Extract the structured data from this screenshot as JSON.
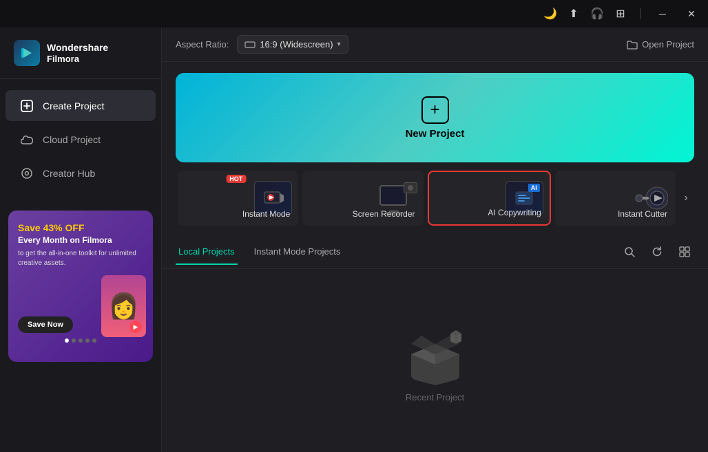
{
  "titlebar": {
    "icons": [
      "sun-icon",
      "upload-icon",
      "headset-icon",
      "grid-icon",
      "minimize-icon",
      "close-icon"
    ]
  },
  "sidebar": {
    "logo": {
      "title": "Wondershare",
      "subtitle": "Filmora"
    },
    "nav": [
      {
        "id": "create-project",
        "label": "Create Project",
        "icon": "➕",
        "active": true
      },
      {
        "id": "cloud-project",
        "label": "Cloud Project",
        "icon": "☁",
        "active": false
      },
      {
        "id": "creator-hub",
        "label": "Creator Hub",
        "icon": "💡",
        "active": false
      }
    ],
    "ad": {
      "title_line1": "Save 43% OFF",
      "subtitle": "Every Month on Filmora",
      "desc": "to get the all-in-one toolkit for unlimited creative assets.",
      "button_label": "Save Now"
    },
    "dots": [
      true,
      false,
      false,
      false,
      false
    ]
  },
  "topbar": {
    "aspect_label": "Aspect Ratio:",
    "aspect_value": "16:9 (Widescreen)",
    "open_project_label": "Open Project"
  },
  "new_project": {
    "label": "New Project"
  },
  "quick_actions": [
    {
      "id": "instant-mode",
      "label": "Instant Mode",
      "badge": "HOT",
      "icon": "🎬"
    },
    {
      "id": "screen-recorder",
      "label": "Screen Recorder",
      "badge": null,
      "icon": "🖥"
    },
    {
      "id": "ai-copywriting",
      "label": "AI Copywriting",
      "badge": null,
      "icon": "🤖",
      "highlighted": true
    },
    {
      "id": "instant-cutter",
      "label": "Instant Cutter",
      "badge": null,
      "icon": "✂️"
    }
  ],
  "tabs": [
    {
      "id": "local-projects",
      "label": "Local Projects",
      "active": true
    },
    {
      "id": "instant-mode-projects",
      "label": "Instant Mode Projects",
      "active": false
    }
  ],
  "tab_actions": [
    {
      "id": "search",
      "icon": "🔍"
    },
    {
      "id": "refresh",
      "icon": "🔄"
    },
    {
      "id": "grid-view",
      "icon": "⊞"
    }
  ],
  "projects_area": {
    "empty_label": "Recent Project"
  }
}
